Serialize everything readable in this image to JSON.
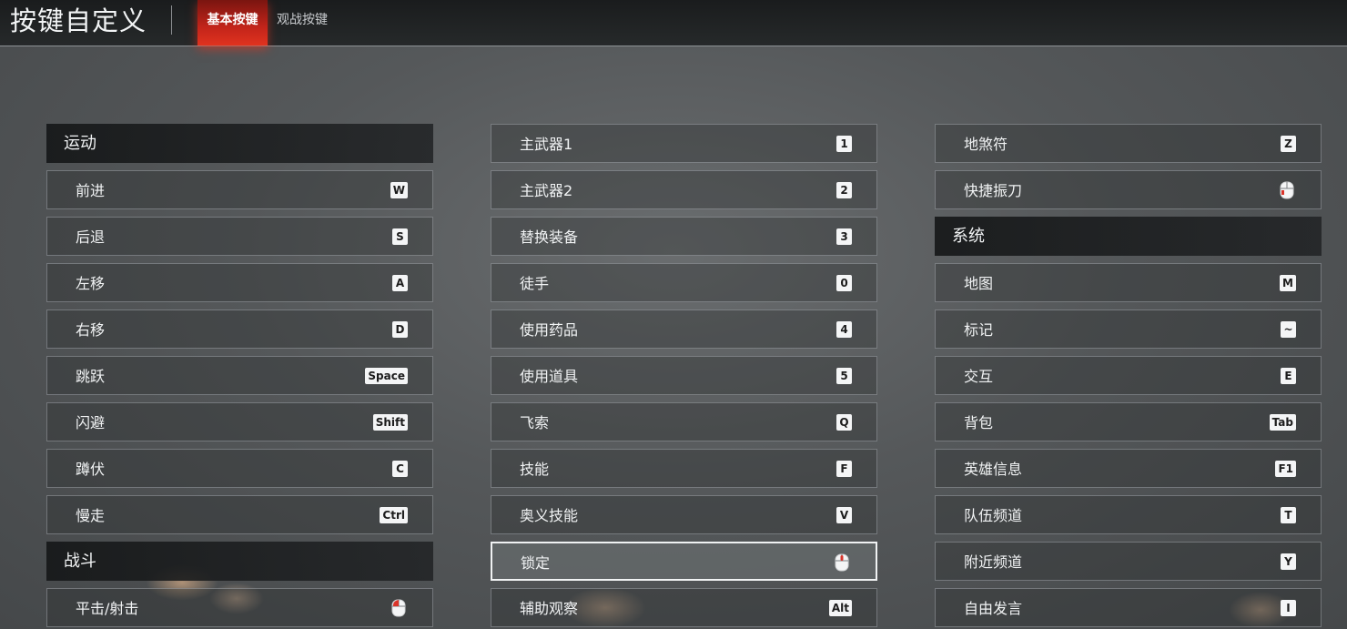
{
  "header": {
    "title": "按键自定义",
    "tabs": [
      {
        "label": "基本按键",
        "active": true
      },
      {
        "label": "观战按键",
        "active": false
      }
    ]
  },
  "columns": [
    {
      "rows": [
        {
          "type": "header",
          "label": "运动"
        },
        {
          "type": "bind",
          "label": "前进",
          "key": "W"
        },
        {
          "type": "bind",
          "label": "后退",
          "key": "S"
        },
        {
          "type": "bind",
          "label": "左移",
          "key": "A"
        },
        {
          "type": "bind",
          "label": "右移",
          "key": "D"
        },
        {
          "type": "bind",
          "label": "跳跃",
          "key": "Space"
        },
        {
          "type": "bind",
          "label": "闪避",
          "key": "Shift"
        },
        {
          "type": "bind",
          "label": "蹲伏",
          "key": "C"
        },
        {
          "type": "bind",
          "label": "慢走",
          "key": "Ctrl"
        },
        {
          "type": "header",
          "label": "战斗"
        },
        {
          "type": "bind",
          "label": "平击/射击",
          "icon": "mouse-left-icon"
        }
      ]
    },
    {
      "rows": [
        {
          "type": "bind",
          "label": "主武器1",
          "key": "1"
        },
        {
          "type": "bind",
          "label": "主武器2",
          "key": "2"
        },
        {
          "type": "bind",
          "label": "替换装备",
          "key": "3"
        },
        {
          "type": "bind",
          "label": "徒手",
          "key": "0"
        },
        {
          "type": "bind",
          "label": "使用药品",
          "key": "4"
        },
        {
          "type": "bind",
          "label": "使用道具",
          "key": "5"
        },
        {
          "type": "bind",
          "label": "飞索",
          "key": "Q"
        },
        {
          "type": "bind",
          "label": "技能",
          "key": "F"
        },
        {
          "type": "bind",
          "label": "奥义技能",
          "key": "V"
        },
        {
          "type": "bind",
          "label": "锁定",
          "icon": "mouse-middle-icon",
          "selected": true
        },
        {
          "type": "bind",
          "label": "辅助观察",
          "key": "Alt"
        }
      ]
    },
    {
      "rows": [
        {
          "type": "bind",
          "label": "地煞符",
          "key": "Z"
        },
        {
          "type": "bind",
          "label": "快捷振刀",
          "icon": "mouse-side-icon"
        },
        {
          "type": "header",
          "label": "系统"
        },
        {
          "type": "bind",
          "label": "地图",
          "key": "M"
        },
        {
          "type": "bind",
          "label": "标记",
          "key": "~"
        },
        {
          "type": "bind",
          "label": "交互",
          "key": "E"
        },
        {
          "type": "bind",
          "label": "背包",
          "key": "Tab"
        },
        {
          "type": "bind",
          "label": "英雄信息",
          "key": "F1"
        },
        {
          "type": "bind",
          "label": "队伍频道",
          "key": "T"
        },
        {
          "type": "bind",
          "label": "附近频道",
          "key": "Y"
        },
        {
          "type": "bind",
          "label": "自由发言",
          "key": "I"
        }
      ]
    }
  ],
  "colors": {
    "tab_active": "#c3241a",
    "mouse_highlight": "#d9342a",
    "key_bg": "#f4f5f6"
  }
}
